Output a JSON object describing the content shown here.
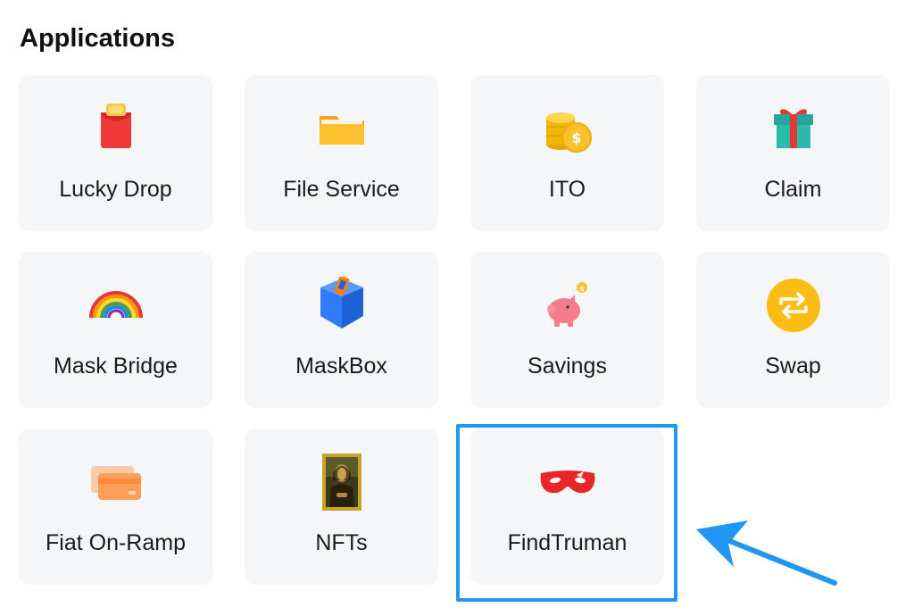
{
  "section_title": "Applications",
  "apps": [
    {
      "label": "Lucky Drop",
      "icon": "red-packet-icon"
    },
    {
      "label": "File Service",
      "icon": "folder-icon"
    },
    {
      "label": "ITO",
      "icon": "coins-icon"
    },
    {
      "label": "Claim",
      "icon": "gift-icon"
    },
    {
      "label": "Mask Bridge",
      "icon": "rainbow-icon"
    },
    {
      "label": "MaskBox",
      "icon": "box-icon"
    },
    {
      "label": "Savings",
      "icon": "piggy-bank-icon"
    },
    {
      "label": "Swap",
      "icon": "swap-icon"
    },
    {
      "label": "Fiat On-Ramp",
      "icon": "credit-card-icon"
    },
    {
      "label": "NFTs",
      "icon": "mona-lisa-icon"
    },
    {
      "label": "FindTruman",
      "icon": "red-mask-icon"
    }
  ],
  "highlighted_app": "FindTruman",
  "colors": {
    "tile_bg": "#f5f6f7",
    "highlight": "#2196f3",
    "arrow": "#2196f3"
  }
}
